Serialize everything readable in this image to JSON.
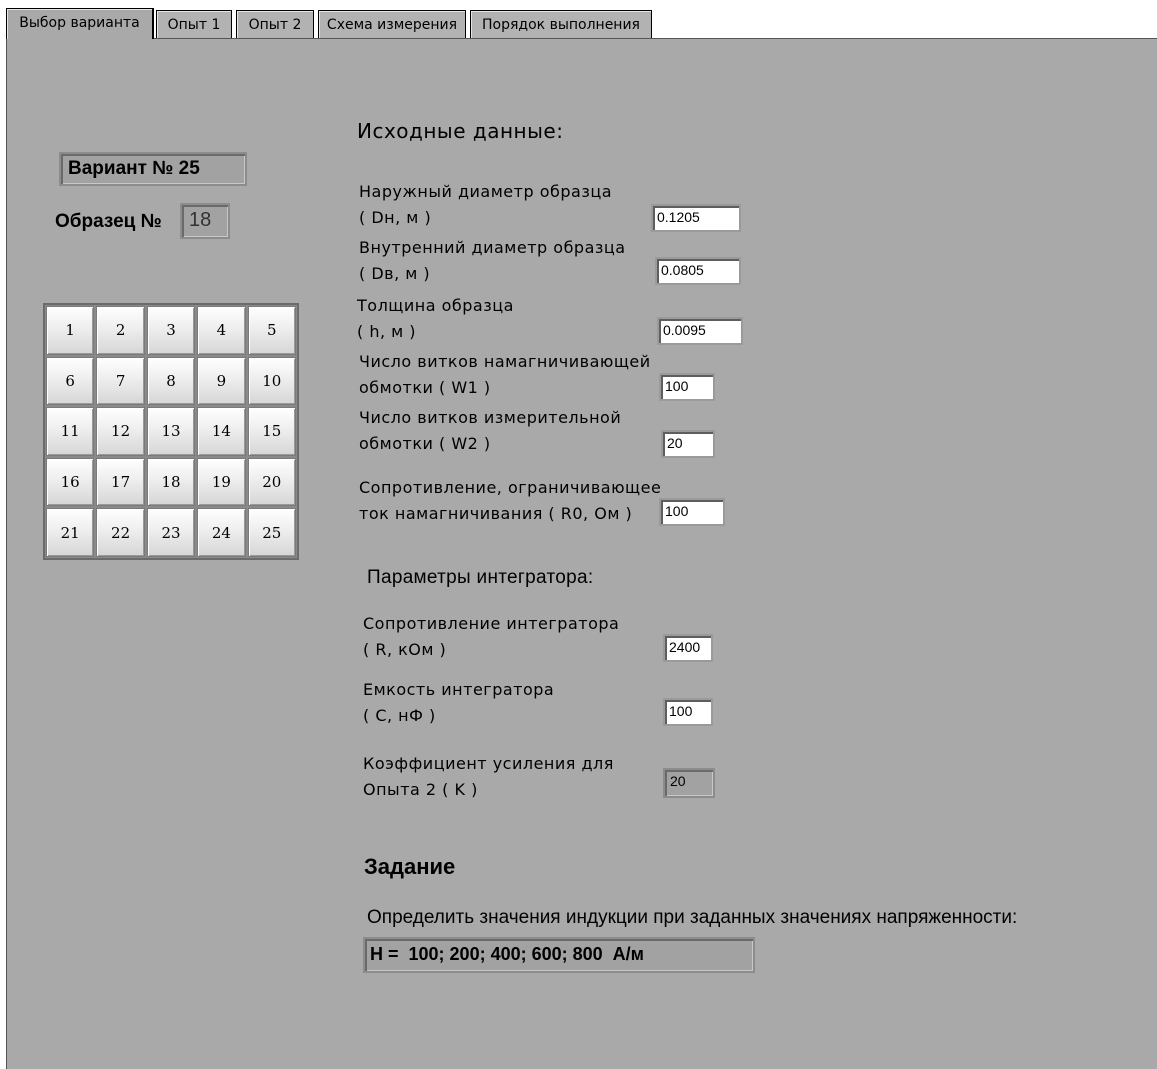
{
  "tabs": [
    "Выбор варианта",
    "Опыт 1",
    "Опыт 2",
    "Схема измерения",
    "Порядок выполнения"
  ],
  "variant_label": "Вариант № 25",
  "sample_label": "Образец №",
  "sample_value": "18",
  "grid_numbers": [
    "1",
    "2",
    "3",
    "4",
    "5",
    "6",
    "7",
    "8",
    "9",
    "10",
    "11",
    "12",
    "13",
    "14",
    "15",
    "16",
    "17",
    "18",
    "19",
    "20",
    "21",
    "22",
    "23",
    "24",
    "25"
  ],
  "initial": {
    "title": "Исходные данные:",
    "outer_d": {
      "line1": "Наружный диаметр образца",
      "line2": " ( Dн, м )",
      "value": "0.1205"
    },
    "inner_d": {
      "line1": "Внутренний диаметр образца",
      "line2": " ( Dв, м )",
      "value": "0.0805"
    },
    "thickness": {
      "line1": "Толщина образца",
      "line2": " ( h, м )",
      "value": "0.0095"
    },
    "w1": {
      "line1": "Число витков намагничивающей",
      "line2": "обмотки  ( W1 )",
      "value": "100"
    },
    "w2": {
      "line1": "Число витков измерительной",
      "line2": "обмотки  ( W2 )",
      "value": "20"
    },
    "r0": {
      "line1": "Сопротивление, ограничивающее",
      "line2": "ток намагничивания  ( R0, Ом )",
      "value": "100"
    }
  },
  "integrator": {
    "title": "Параметры интегратора:",
    "r": {
      "line1": "Сопротивление интегратора",
      "line2": " ( R, кОм )",
      "value": "2400"
    },
    "c": {
      "line1": "Емкость интегратора",
      "line2": " ( С, нФ )",
      "value": "100"
    },
    "k": {
      "line1": "Коэффициент усиления для",
      "line2": "Опыта 2 ( K )",
      "value": "20"
    }
  },
  "task": {
    "title": "Задание",
    "text": "Определить значения индукции при заданных значениях напряженности:",
    "value": "H =  100; 200; 400; 600; 800  А/м"
  }
}
